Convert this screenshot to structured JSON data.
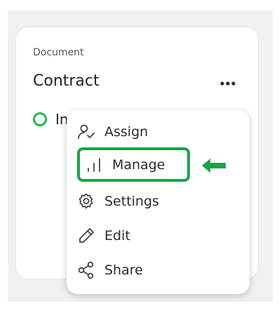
{
  "card": {
    "kind": "Document",
    "title": "Contract",
    "status_text": "In"
  },
  "menu": {
    "items": [
      {
        "label": "Assign",
        "icon": "person-check-icon"
      },
      {
        "label": "Manage",
        "icon": "bar-chart-icon",
        "highlighted": true
      },
      {
        "label": "Settings",
        "icon": "gear-icon"
      },
      {
        "label": "Edit",
        "icon": "pencil-icon"
      },
      {
        "label": "Share",
        "icon": "share-icon"
      }
    ]
  },
  "colors": {
    "accent_green": "#12a64a",
    "status_green": "#1db954",
    "backdrop": "#f0f0f0"
  }
}
